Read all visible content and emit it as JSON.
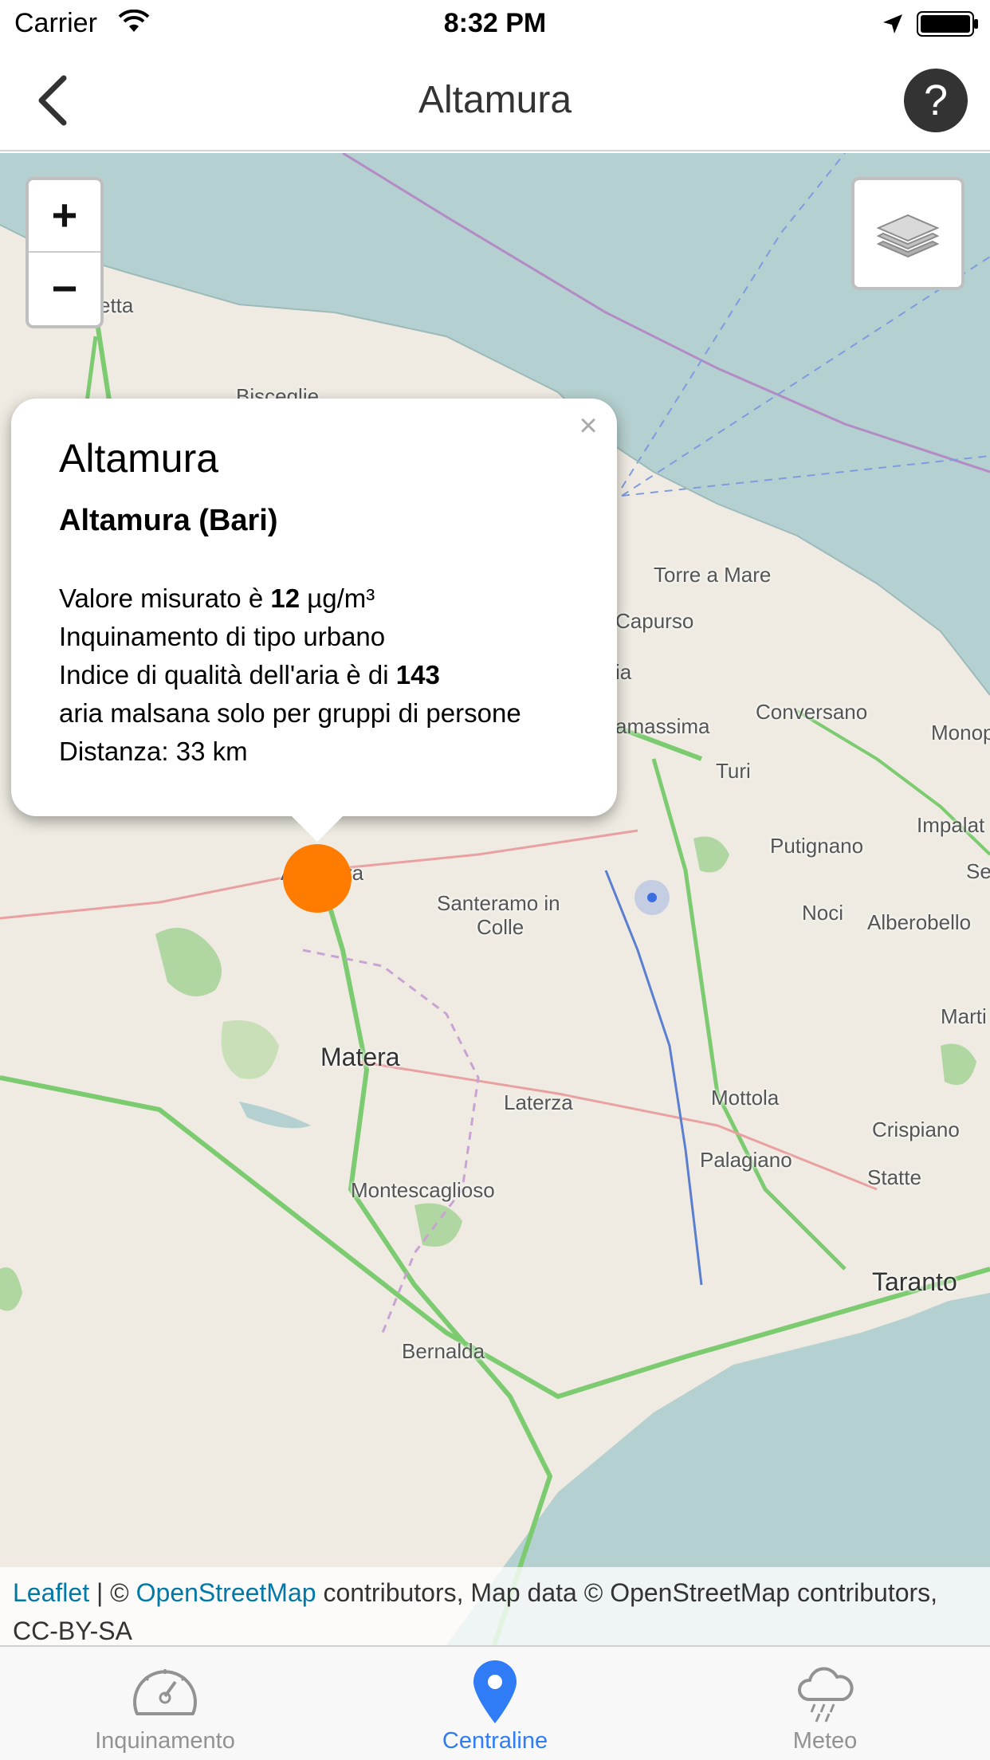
{
  "status_bar": {
    "carrier": "Carrier",
    "time": "8:32 PM",
    "icons": [
      "wifi-icon",
      "location-arrow-icon",
      "battery-icon"
    ]
  },
  "nav": {
    "title": "Altamura",
    "back_icon": "chevron-left-icon",
    "help_label": "?"
  },
  "map": {
    "zoom_in_label": "+",
    "zoom_out_label": "−",
    "layers_icon": "layers-icon",
    "marker_color": "#ff7c00",
    "labels": {
      "barletta": "etta",
      "bisceglie": "Bisceglie",
      "torre_a_mare": "Torre a Mare",
      "capurso": "Capurso",
      "noicattaro": "ia",
      "casamassima": "amassima",
      "conversano": "Conversano",
      "monopoli": "Monop",
      "turi": "Turi",
      "putignano": "Putignano",
      "impalata": "Impalat",
      "selva": "Se",
      "altamura": "Altamura",
      "santeramo1": "Santeramo in",
      "santeramo2": "Colle",
      "noci": "Noci",
      "alberobello": "Alberobello",
      "martina": "Marti",
      "matera": "Matera",
      "laterza": "Laterza",
      "mottola": "Mottola",
      "crispiano": "Crispiano",
      "palagiano": "Palagiano",
      "statte": "Statte",
      "montescaglioso": "Montescaglioso",
      "taranto": "Taranto",
      "bernalda": "Bernalda"
    }
  },
  "popup": {
    "close_label": "×",
    "title": "Altamura",
    "subtitle": "Altamura (Bari)",
    "measured_prefix": "Valore misurato è ",
    "measured_value": "12",
    "measured_unit": " µg/m³",
    "pollution_type": "Inquinamento di tipo urbano",
    "aqi_prefix": "Indice di qualità dell'aria è di ",
    "aqi_value": "143",
    "air_status": "aria malsana solo per gruppi di persone",
    "distance": "Distanza: 33 km"
  },
  "attribution": {
    "leaflet": "Leaflet",
    "separator": " | © ",
    "osm": "OpenStreetMap",
    "rest": " contributors, Map data © OpenStreetMap contributors, CC-BY-SA"
  },
  "tabs": [
    {
      "label": "Inquinamento",
      "icon": "gauge-icon",
      "active": false
    },
    {
      "label": "Centraline",
      "icon": "map-pin-icon",
      "active": true
    },
    {
      "label": "Meteo",
      "icon": "cloud-rain-icon",
      "active": false
    }
  ],
  "colors": {
    "accent": "#2f7cf6",
    "sea": "#b5d0d0",
    "land": "#efebe2",
    "forest": "#b0d6a2",
    "motorway": "#7ccb71"
  }
}
